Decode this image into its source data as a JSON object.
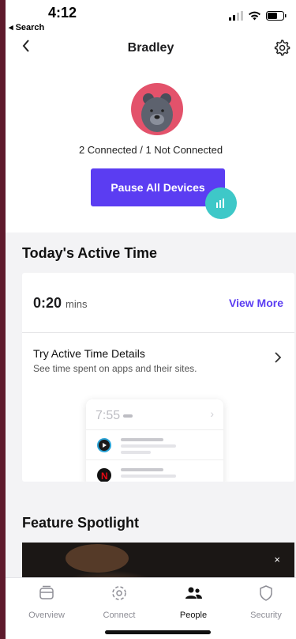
{
  "status_bar": {
    "time": "4:12",
    "back_app": "◂ Search"
  },
  "nav": {
    "title": "Bradley"
  },
  "profile": {
    "connection_status": "2 Connected / 1 Not Connected",
    "pause_button": "Pause All Devices"
  },
  "active_time": {
    "section_title": "Today's Active Time",
    "value": "0:20",
    "unit": "mins",
    "view_more": "View More",
    "details_title": "Try Active Time Details",
    "details_subtitle": "See time spent on apps and their sites.",
    "preview_time": "7:55"
  },
  "feature": {
    "section_title": "Feature Spotlight",
    "close_label": "×"
  },
  "tabs": [
    {
      "label": "Overview",
      "icon": "overview-icon",
      "active": false
    },
    {
      "label": "Connect",
      "icon": "connect-icon",
      "active": false
    },
    {
      "label": "People",
      "icon": "people-icon",
      "active": true
    },
    {
      "label": "Security",
      "icon": "shield-icon",
      "active": false
    }
  ],
  "colors": {
    "accent": "#5b3df2",
    "avatar_bg": "#e3526b",
    "fab": "#3ec8c8",
    "frame": "#5e1a2c"
  }
}
